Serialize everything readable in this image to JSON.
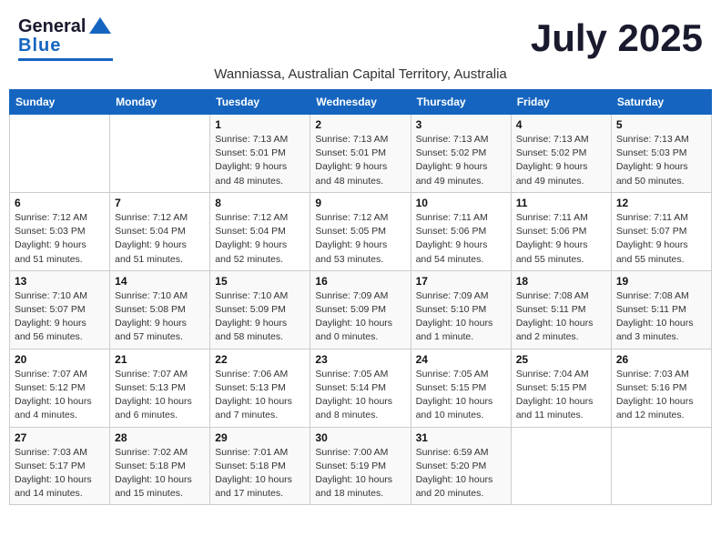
{
  "header": {
    "logo_line1": "General",
    "logo_line2": "Blue",
    "month_title": "July 2025",
    "subtitle": "Wanniassa, Australian Capital Territory, Australia"
  },
  "days_of_week": [
    "Sunday",
    "Monday",
    "Tuesday",
    "Wednesday",
    "Thursday",
    "Friday",
    "Saturday"
  ],
  "weeks": [
    [
      {
        "day": "",
        "info": ""
      },
      {
        "day": "",
        "info": ""
      },
      {
        "day": "1",
        "info": "Sunrise: 7:13 AM\nSunset: 5:01 PM\nDaylight: 9 hours\nand 48 minutes."
      },
      {
        "day": "2",
        "info": "Sunrise: 7:13 AM\nSunset: 5:01 PM\nDaylight: 9 hours\nand 48 minutes."
      },
      {
        "day": "3",
        "info": "Sunrise: 7:13 AM\nSunset: 5:02 PM\nDaylight: 9 hours\nand 49 minutes."
      },
      {
        "day": "4",
        "info": "Sunrise: 7:13 AM\nSunset: 5:02 PM\nDaylight: 9 hours\nand 49 minutes."
      },
      {
        "day": "5",
        "info": "Sunrise: 7:13 AM\nSunset: 5:03 PM\nDaylight: 9 hours\nand 50 minutes."
      }
    ],
    [
      {
        "day": "6",
        "info": "Sunrise: 7:12 AM\nSunset: 5:03 PM\nDaylight: 9 hours\nand 51 minutes."
      },
      {
        "day": "7",
        "info": "Sunrise: 7:12 AM\nSunset: 5:04 PM\nDaylight: 9 hours\nand 51 minutes."
      },
      {
        "day": "8",
        "info": "Sunrise: 7:12 AM\nSunset: 5:04 PM\nDaylight: 9 hours\nand 52 minutes."
      },
      {
        "day": "9",
        "info": "Sunrise: 7:12 AM\nSunset: 5:05 PM\nDaylight: 9 hours\nand 53 minutes."
      },
      {
        "day": "10",
        "info": "Sunrise: 7:11 AM\nSunset: 5:06 PM\nDaylight: 9 hours\nand 54 minutes."
      },
      {
        "day": "11",
        "info": "Sunrise: 7:11 AM\nSunset: 5:06 PM\nDaylight: 9 hours\nand 55 minutes."
      },
      {
        "day": "12",
        "info": "Sunrise: 7:11 AM\nSunset: 5:07 PM\nDaylight: 9 hours\nand 55 minutes."
      }
    ],
    [
      {
        "day": "13",
        "info": "Sunrise: 7:10 AM\nSunset: 5:07 PM\nDaylight: 9 hours\nand 56 minutes."
      },
      {
        "day": "14",
        "info": "Sunrise: 7:10 AM\nSunset: 5:08 PM\nDaylight: 9 hours\nand 57 minutes."
      },
      {
        "day": "15",
        "info": "Sunrise: 7:10 AM\nSunset: 5:09 PM\nDaylight: 9 hours\nand 58 minutes."
      },
      {
        "day": "16",
        "info": "Sunrise: 7:09 AM\nSunset: 5:09 PM\nDaylight: 10 hours\nand 0 minutes."
      },
      {
        "day": "17",
        "info": "Sunrise: 7:09 AM\nSunset: 5:10 PM\nDaylight: 10 hours\nand 1 minute."
      },
      {
        "day": "18",
        "info": "Sunrise: 7:08 AM\nSunset: 5:11 PM\nDaylight: 10 hours\nand 2 minutes."
      },
      {
        "day": "19",
        "info": "Sunrise: 7:08 AM\nSunset: 5:11 PM\nDaylight: 10 hours\nand 3 minutes."
      }
    ],
    [
      {
        "day": "20",
        "info": "Sunrise: 7:07 AM\nSunset: 5:12 PM\nDaylight: 10 hours\nand 4 minutes."
      },
      {
        "day": "21",
        "info": "Sunrise: 7:07 AM\nSunset: 5:13 PM\nDaylight: 10 hours\nand 6 minutes."
      },
      {
        "day": "22",
        "info": "Sunrise: 7:06 AM\nSunset: 5:13 PM\nDaylight: 10 hours\nand 7 minutes."
      },
      {
        "day": "23",
        "info": "Sunrise: 7:05 AM\nSunset: 5:14 PM\nDaylight: 10 hours\nand 8 minutes."
      },
      {
        "day": "24",
        "info": "Sunrise: 7:05 AM\nSunset: 5:15 PM\nDaylight: 10 hours\nand 10 minutes."
      },
      {
        "day": "25",
        "info": "Sunrise: 7:04 AM\nSunset: 5:15 PM\nDaylight: 10 hours\nand 11 minutes."
      },
      {
        "day": "26",
        "info": "Sunrise: 7:03 AM\nSunset: 5:16 PM\nDaylight: 10 hours\nand 12 minutes."
      }
    ],
    [
      {
        "day": "27",
        "info": "Sunrise: 7:03 AM\nSunset: 5:17 PM\nDaylight: 10 hours\nand 14 minutes."
      },
      {
        "day": "28",
        "info": "Sunrise: 7:02 AM\nSunset: 5:18 PM\nDaylight: 10 hours\nand 15 minutes."
      },
      {
        "day": "29",
        "info": "Sunrise: 7:01 AM\nSunset: 5:18 PM\nDaylight: 10 hours\nand 17 minutes."
      },
      {
        "day": "30",
        "info": "Sunrise: 7:00 AM\nSunset: 5:19 PM\nDaylight: 10 hours\nand 18 minutes."
      },
      {
        "day": "31",
        "info": "Sunrise: 6:59 AM\nSunset: 5:20 PM\nDaylight: 10 hours\nand 20 minutes."
      },
      {
        "day": "",
        "info": ""
      },
      {
        "day": "",
        "info": ""
      }
    ]
  ]
}
